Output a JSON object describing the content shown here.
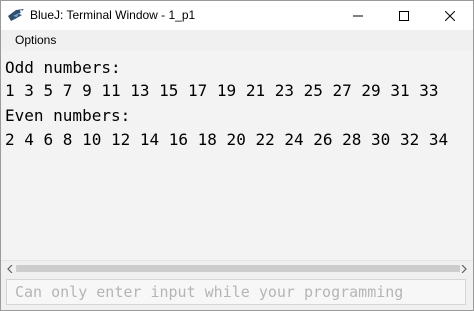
{
  "window": {
    "title": "BlueJ: Terminal Window - 1_p1"
  },
  "menu": {
    "options_label": "Options"
  },
  "output": {
    "lines": [
      "Odd numbers:",
      "1 3 5 7 9 11 13 15 17 19 21 23 25 27 29 31 33",
      "Even numbers:",
      "2 4 6 8 10 12 14 16 18 20 22 24 26 28 30 32 34"
    ]
  },
  "input": {
    "placeholder": "Can only enter input while your programming"
  },
  "colors": {
    "output_background": "#f3f3f3",
    "text": "#000000",
    "placeholder": "#b5b5b5"
  },
  "icons": {
    "app": "bluej-bird-icon",
    "minimize": "minimize-icon",
    "maximize": "maximize-icon",
    "close": "close-icon",
    "scroll_left": "chevron-left-icon",
    "scroll_right": "chevron-right-icon"
  }
}
